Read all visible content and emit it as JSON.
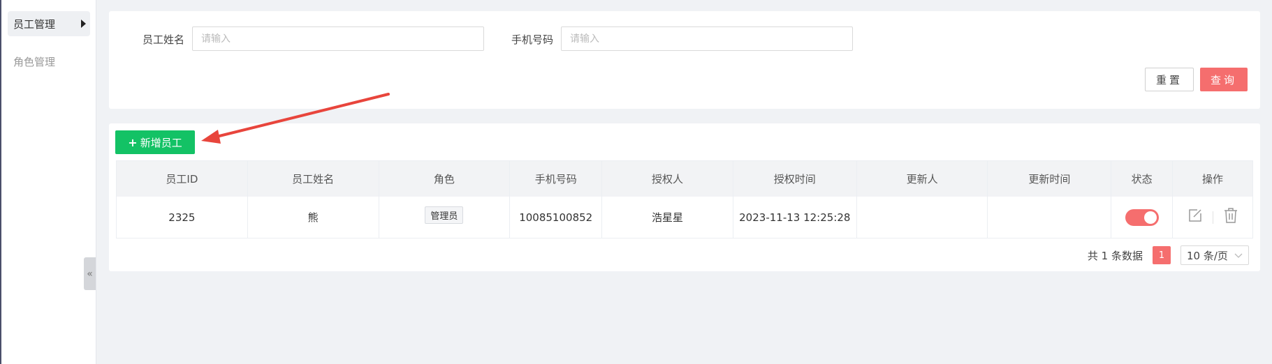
{
  "sidebar": {
    "items": [
      {
        "label": "员工管理"
      },
      {
        "label": "角色管理"
      }
    ]
  },
  "search": {
    "name_label": "员工姓名",
    "name_placeholder": "请输入",
    "phone_label": "手机号码",
    "phone_placeholder": "请输入",
    "reset_label": "重置",
    "query_label": "查询"
  },
  "toolbar": {
    "add_label": "新增员工"
  },
  "table": {
    "columns": [
      "员工ID",
      "员工姓名",
      "角色",
      "手机号码",
      "授权人",
      "授权时间",
      "更新人",
      "更新时间",
      "状态",
      "操作"
    ],
    "rows": [
      {
        "id": "2325",
        "name": "熊",
        "role": "管理员",
        "phone": "10085100852",
        "authorizer": "浩星星",
        "auth_time": "2023-11-13 12:25:28",
        "updater": "",
        "update_time": "",
        "status_on": true
      }
    ]
  },
  "pagination": {
    "total_text": "共 1 条数据",
    "current_page": "1",
    "page_size": "10 条/页"
  },
  "colors": {
    "primary_red": "#f56e6e",
    "add_green": "#13c265",
    "arrow_red": "#e8453c"
  },
  "icons": {
    "collapse": "double-chevron-left-icon",
    "edit": "edit-icon",
    "delete": "trash-icon",
    "dropdown": "chevron-down-icon"
  }
}
